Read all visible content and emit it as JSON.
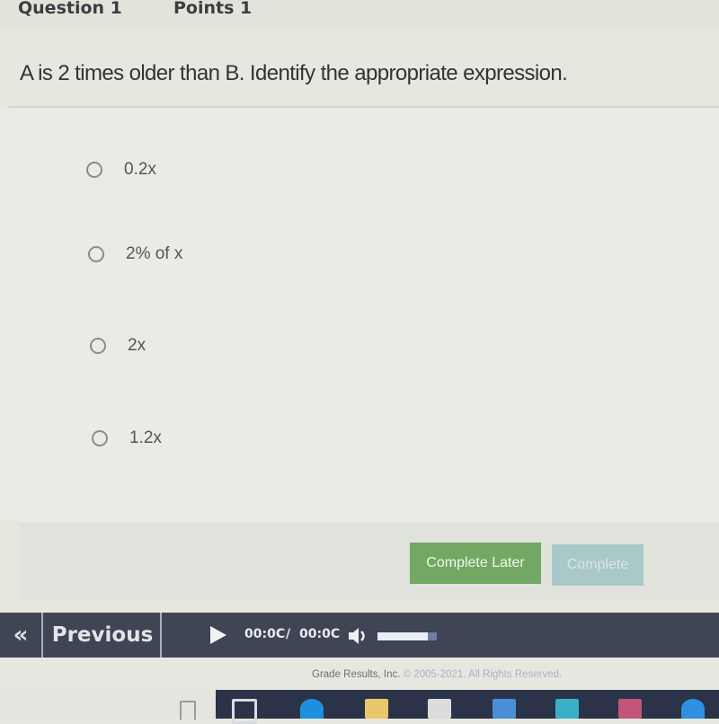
{
  "header": {
    "question_label": "Question 1",
    "points_label": "Points 1"
  },
  "question": {
    "text": "A is 2 times older than B. Identify the appropriate expression."
  },
  "options": [
    {
      "label": "0.2x",
      "selected": false
    },
    {
      "label": "2% of x",
      "selected": false
    },
    {
      "label": "2x",
      "selected": false
    },
    {
      "label": "1.2x",
      "selected": false
    }
  ],
  "actions": {
    "complete_later": "Complete Later",
    "complete": "Complete"
  },
  "nav": {
    "first_icon": "«",
    "previous": "Previous"
  },
  "player": {
    "current_time": "00:0C",
    "separator": "/",
    "total_time": "00:0C",
    "volume_level": 0.85
  },
  "footer": {
    "company": "Grade Results, Inc.",
    "copyright": "© 2005-2021. All Rights Reserved."
  },
  "taskbar": {
    "icons": [
      "task-view-icon",
      "edge-icon",
      "file-explorer-icon",
      "store-icon",
      "app-icon",
      "app-icon-2",
      "app-icon-3",
      "app-icon-4"
    ]
  },
  "colors": {
    "accent_green": "#73a864",
    "disabled_button": "#a9c8c8",
    "nav_bar": "#3f4554"
  }
}
